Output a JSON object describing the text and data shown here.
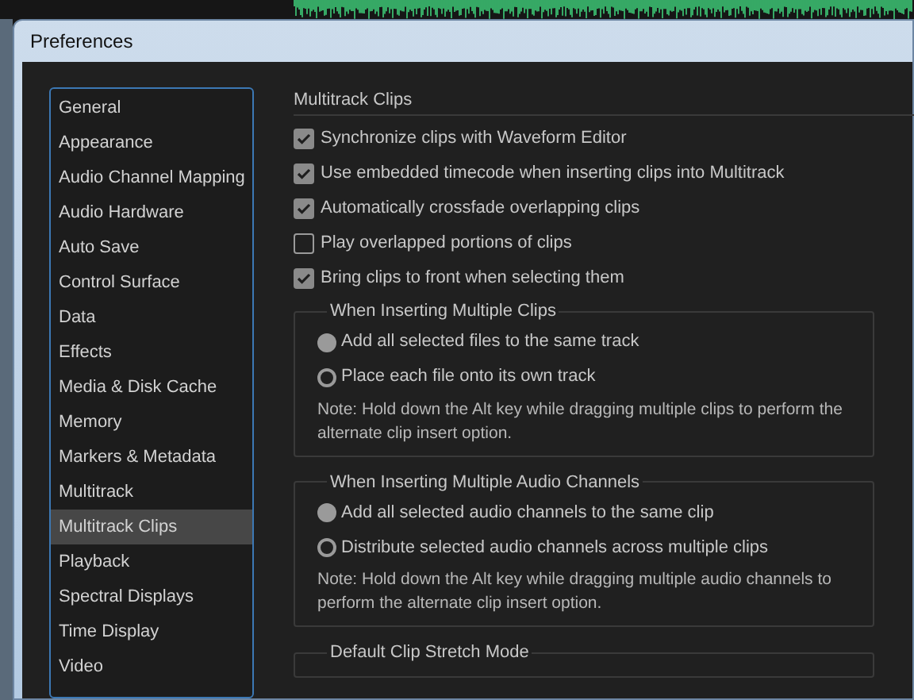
{
  "window": {
    "title": "Preferences"
  },
  "sidebar": {
    "items": [
      {
        "label": "General",
        "selected": false
      },
      {
        "label": "Appearance",
        "selected": false
      },
      {
        "label": "Audio Channel Mapping",
        "selected": false
      },
      {
        "label": "Audio Hardware",
        "selected": false
      },
      {
        "label": "Auto Save",
        "selected": false
      },
      {
        "label": "Control Surface",
        "selected": false
      },
      {
        "label": "Data",
        "selected": false
      },
      {
        "label": "Effects",
        "selected": false
      },
      {
        "label": "Media & Disk Cache",
        "selected": false
      },
      {
        "label": "Memory",
        "selected": false
      },
      {
        "label": "Markers & Metadata",
        "selected": false
      },
      {
        "label": "Multitrack",
        "selected": false
      },
      {
        "label": "Multitrack Clips",
        "selected": true
      },
      {
        "label": "Playback",
        "selected": false
      },
      {
        "label": "Spectral Displays",
        "selected": false
      },
      {
        "label": "Time Display",
        "selected": false
      },
      {
        "label": "Video",
        "selected": false
      }
    ]
  },
  "section": {
    "title": "Multitrack Clips",
    "options": [
      {
        "label": "Synchronize clips with Waveform Editor",
        "checked": true
      },
      {
        "label": "Use embedded timecode when inserting clips into Multitrack",
        "checked": true
      },
      {
        "label": "Automatically crossfade overlapping clips",
        "checked": true
      },
      {
        "label": "Play overlapped portions of clips",
        "checked": false
      },
      {
        "label": "Bring clips to front when selecting them",
        "checked": true
      }
    ],
    "groups": [
      {
        "title": "When Inserting Multiple Clips",
        "choices": [
          {
            "label": "Add all selected files to the same track",
            "selected": true
          },
          {
            "label": "Place each file onto its own track",
            "selected": false
          }
        ],
        "note": "Note: Hold down the Alt key while dragging multiple clips to perform the alternate clip insert option."
      },
      {
        "title": "When Inserting Multiple Audio Channels",
        "choices": [
          {
            "label": "Add all selected audio channels to the same clip",
            "selected": true
          },
          {
            "label": "Distribute selected audio channels across multiple clips",
            "selected": false
          }
        ],
        "note": "Note: Hold down the Alt key while dragging multiple audio channels to perform the alternate clip insert option."
      },
      {
        "title": "Default Clip Stretch Mode"
      }
    ]
  }
}
